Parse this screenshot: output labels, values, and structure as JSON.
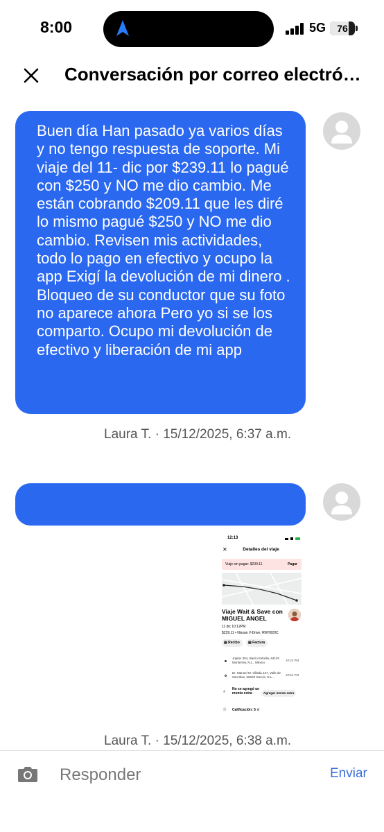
{
  "status_bar": {
    "time": "8:00",
    "network": "5G",
    "battery": "76",
    "battery_level": 0.76
  },
  "header": {
    "title": "Conversación por correo electrónico"
  },
  "messages": [
    {
      "text": "Buen día Han pasado ya varios días y no tengo respuesta de soporte. Mi viaje del 11- dic por $239.11 lo pagué con $250 y NO me dio cambio. Me están cobrando $209.11 que les diré lo mismo pagué $250 y NO me dio cambio. Revisen mis actividades, todo lo pago en efectivo y ocupo la app Exigí la devolución de mi dinero . Bloqueo de su conductor que su foto no aparece ahora Pero yo si se los comparto. Ocupo mi devolución de efectivo y liberación de mi app",
      "author_time": "Laura T. · 15/12/2025, 6:37 a.m."
    },
    {
      "text": "",
      "author_time": "Laura T. · 15/12/2025, 6:38 a.m."
    }
  ],
  "attachment": {
    "time": "12:13",
    "title": "Detalles del viaje",
    "banner": "Viaje sin pagar: $239.11",
    "pay": "Pagar",
    "trip_title": "Viaje Wait & Save con MIGUEL ANGEL",
    "date": "11 dic 10:12PM",
    "car": "$239.11 • Nissan V-Drive, RWY620C",
    "receipt": "Recibo",
    "invoice": "Factura",
    "stop1": "Júpiter 304, Barrio Estrella, 64102 Monterrey, N.L., México",
    "stop1_time": "10:24 PM",
    "stop2": "Dr. Manuel M. Villada 237, Valle de San Blas, 66003 García, N.L...",
    "stop2_time": "10:51 PM",
    "no_tip": "No se agregó un monto extra",
    "add_tip": "Agregar monto extra",
    "rating": "Calificación: 5 ☆"
  },
  "footer": {
    "placeholder": "Responder",
    "send": "Enviar"
  }
}
